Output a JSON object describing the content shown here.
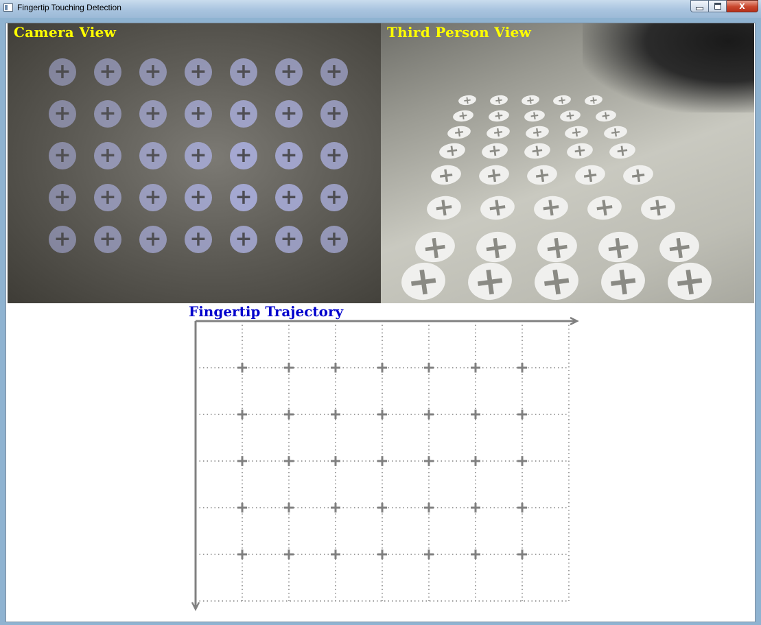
{
  "window": {
    "title": "Fingertip Touching Detection",
    "buttons": {
      "minimize": "minimize",
      "maximize": "maximize",
      "close": "X"
    }
  },
  "panes": {
    "camera": {
      "label": "Camera View"
    },
    "third_person": {
      "label": "Third Person View"
    }
  },
  "trajectory": {
    "title": "Fingertip Trajectory",
    "grid_columns": 7,
    "grid_rows": 5,
    "color_axis": "#808080",
    "color_title": "#0000cc"
  },
  "colors": {
    "pane_label": "#ffff00",
    "camera_dot": "#a8acd8",
    "third_dot": "#f0f0ee"
  }
}
